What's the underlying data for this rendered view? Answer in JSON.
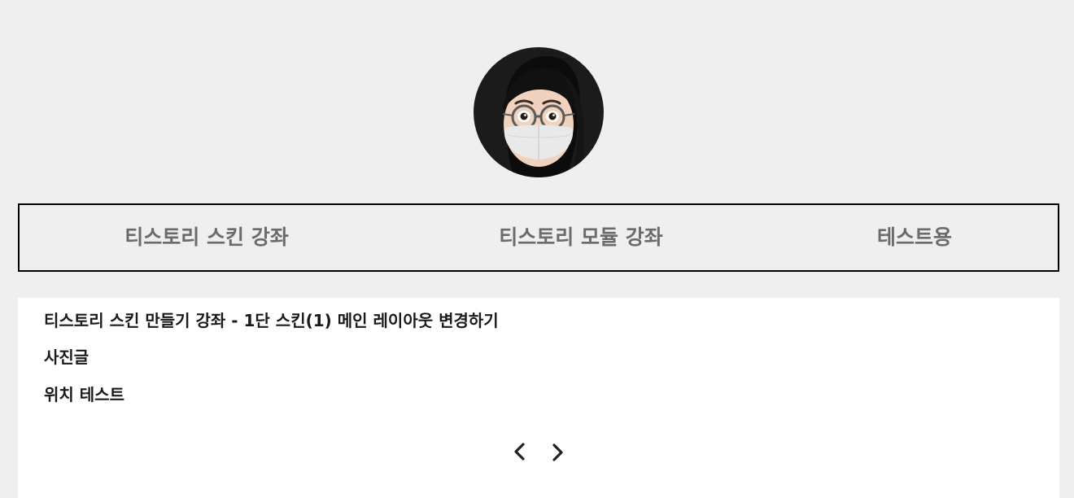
{
  "profile": {
    "avatar_icon": "memoji-avatar-icon"
  },
  "nav": {
    "items": [
      {
        "label": "티스토리 스킨 강좌"
      },
      {
        "label": "티스토리 모듈 강좌"
      },
      {
        "label": "테스트용"
      }
    ]
  },
  "posts": [
    {
      "title": "티스토리 스킨 만들기 강좌 - 1단 스킨(1) 메인 레이아웃 변경하기"
    },
    {
      "title": "사진글"
    },
    {
      "title": "위치 테스트"
    }
  ],
  "pagination": {
    "prev_icon": "chevron-left-icon",
    "next_icon": "chevron-right-icon"
  }
}
